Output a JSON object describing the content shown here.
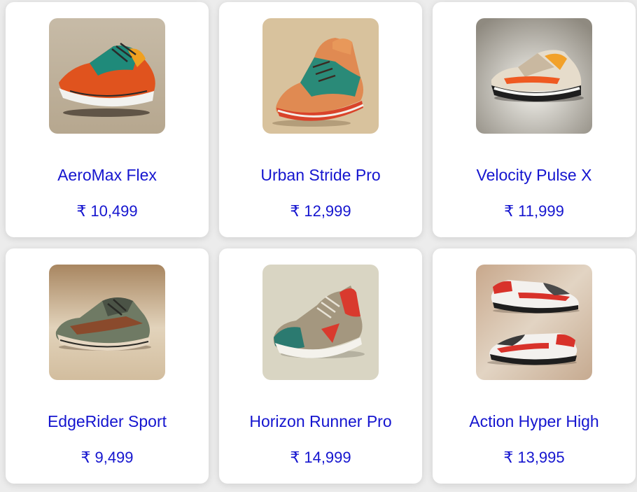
{
  "currency_symbol": "₹",
  "products": [
    {
      "name": "AeroMax Flex",
      "price": "10,499",
      "image_icon": "sneaker-orange-teal-icon"
    },
    {
      "name": "Urban Stride Pro",
      "price": "12,999",
      "image_icon": "sneaker-peach-teal-high-icon"
    },
    {
      "name": "Velocity Pulse X",
      "price": "11,999",
      "image_icon": "sneaker-beige-orange-icon"
    },
    {
      "name": "EdgeRider Sport",
      "price": "9,499",
      "image_icon": "sneaker-olive-brown-icon"
    },
    {
      "name": "Horizon Runner Pro",
      "price": "14,999",
      "image_icon": "sneaker-teal-red-icon"
    },
    {
      "name": "Action Hyper High",
      "price": "13,995",
      "image_icon": "sneaker-pair-red-white-icon"
    }
  ],
  "colors": {
    "text": "#1515cf",
    "card": "#ffffff",
    "page": "#ececec"
  }
}
